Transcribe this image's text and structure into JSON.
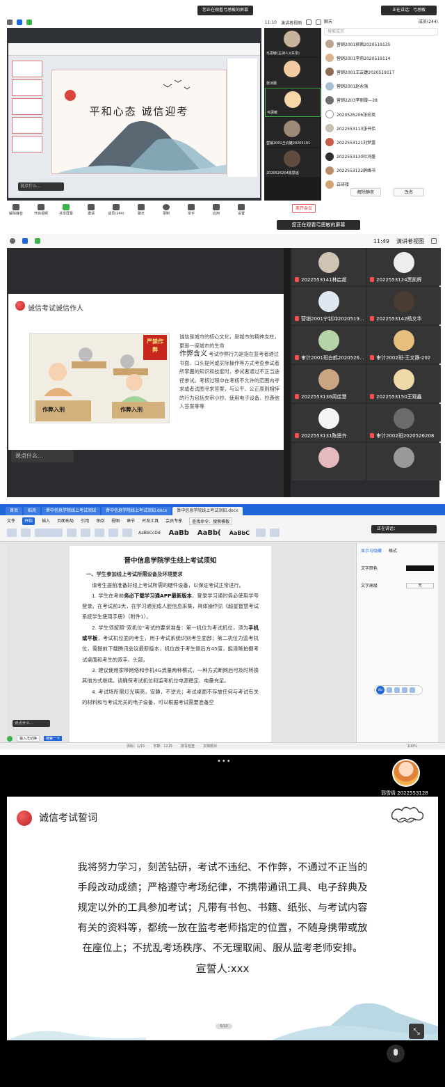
{
  "panel1": {
    "viewing_banner": "您正在观看弓思敏的屏幕",
    "speaking_label": "正在讲话：弓思敏",
    "view_mode": "演讲者视图",
    "time": "11:10",
    "members_title": "成员(244)",
    "chat_label": "聊天",
    "search_placeholder": "搜索成员",
    "slide_title": "平和心态   诚信迎考",
    "comment_placeholder": "说点什么...",
    "video_tiles": [
      {
        "name": "弓思敏(主持人)(共享)"
      },
      {
        "name": "张冰晨"
      },
      {
        "name": "弓思敏"
      },
      {
        "name": "营销2001王云婕20205191"
      },
      {
        "name": "2020526204陈思瑶"
      }
    ],
    "members": [
      {
        "name": "营销2001郭茜2020519135"
      },
      {
        "name": "营销2001李莉2020519114"
      },
      {
        "name": "营销2001王云婕2020519117"
      },
      {
        "name": "营销2001赵永强"
      },
      {
        "name": "营销2203李丽璇—28"
      },
      {
        "name": "2020526206张宏英"
      },
      {
        "name": "2022553113张书伟"
      },
      {
        "name": "2022553121刘梦露"
      },
      {
        "name": "2022553130杜鸿盛"
      },
      {
        "name": "2022553132薛峰书"
      },
      {
        "name": "白研楼"
      }
    ],
    "mute_all_label": "解除静音",
    "rename_label": "改名",
    "toolbar": [
      {
        "label": "解除静音"
      },
      {
        "label": "开启视频"
      },
      {
        "label": "共享屏幕"
      },
      {
        "label": "邀请"
      },
      {
        "label": "成员(244)"
      },
      {
        "label": "聊天"
      },
      {
        "label": "录制"
      },
      {
        "label": "举手"
      },
      {
        "label": "应用"
      },
      {
        "label": "设置"
      }
    ],
    "leave_label": "离开会议"
  },
  "panel2": {
    "viewing_banner": "您正在观看弓思敏的屏幕",
    "time": "11:49",
    "view_mode": "演讲者视图",
    "slide_title": "诚信考试诚信作人",
    "intro_text": "诚信是城市的核心文化，是城市的精神支柱，更是一座城市的生命",
    "heading": "作弊含义",
    "body_text": "考试作弊行为是指在监考者通过书面、口头提问或实际操作等方式考查参试者所掌握的知识和技能时，参试者通过不正当途径参试。考核过程中在考核不允许的范围内寻求或者试图寻求答案，与公平、公正原则相悖的行为包括夹带小抄、使用电子设备、抄袭他人答案等等",
    "sign_left": "作弊入刑",
    "sign_right": "作弊入刑",
    "banner_sign": "严禁作弊",
    "comment_placeholder": "说点什么...",
    "tiles": [
      {
        "name": "2022553141林启超"
      },
      {
        "name": "2022553124贾凯辉"
      },
      {
        "name": "营销2001宁钊冲2020519..."
      },
      {
        "name": "2022553142杨文华"
      },
      {
        "name": "审计2001班白鹤2020526..."
      },
      {
        "name": "审计2002班-王文静-202"
      },
      {
        "name": "2022553136周佳慧"
      },
      {
        "name": "2022553150王观鑫"
      },
      {
        "name": "2022553131陈思齐"
      },
      {
        "name": "审计2002班2020526208"
      },
      {
        "name": ""
      },
      {
        "name": ""
      }
    ]
  },
  "panel3": {
    "tabs": [
      {
        "label": "首页"
      },
      {
        "label": "稻壳"
      },
      {
        "label": "晋中信息学院线上考试须知"
      },
      {
        "label": "晋中信息学院线上考试须知.docx"
      },
      {
        "label": "晋中信息学院线上考试须知.docx"
      }
    ],
    "menu": [
      "文件",
      "开始",
      "插入",
      "页面布局",
      "引用",
      "审阅",
      "视图",
      "章节",
      "开发工具",
      "会员专享"
    ],
    "search_placeholder": "查找命令、搜索模板",
    "styles": [
      "AaBbCcDd",
      "AaBb",
      "AaBb(",
      "AaBbC"
    ],
    "speaker_label": "正在讲话：",
    "doc_title": "晋中信息学院学生线上考试须知",
    "heading1": "一、学生参加线上考试所需设备及环境要求",
    "para0": "请考生提前准备好线上考试所需的硬件设备，以保证考试正常进行。",
    "para1_a": "1. 学生在考前",
    "para1_b": "务必下载学习通APP最新版本",
    "para1_c": "，登录学习通时务必使用学号登录。在考试前3天，在学习通完成人脸信息采集，具体操作见《超星智慧考试系统学生使用手册》（附件1）。",
    "para2_a": "2. 学生须按照\"双机位\"考试的要求准备：第一机位为考试机位，须为",
    "para2_b": "手机或平板",
    "para2_c": "，考试机位面向考生，用于考试系统识别考生面部；第二机位为监考机位，需提前下载腾讯会议最新版本，机位放于考生侧后方45度，能清晰拍摄考试桌面和考生的双手、头部。",
    "para3": "3. 建议使用家带网络和手机4G流量两种模式，一种方式断网后可及时转换其他方式继续。请确保考试机位和监考机位电源稳定、电量充足。",
    "para4": "4. 考试场所需灯光明亮，安静，不逆光；考试桌面不存放任何与考试有关的材料和与考试无关的电子设备，可以根据考试需要准备空",
    "comment_placeholder": "说点什么...",
    "side_tab1": "显示与隐藏",
    "side_tab2": "格式",
    "side_row1": "文字颜色",
    "side_row2": "文字高级",
    "side_row2_value": "无",
    "du_label": "du",
    "taskbar_ime": "输入法切换",
    "taskbar_btn": "搜索一下",
    "status": [
      "页码：1/15",
      "字数：1215",
      "拼写检查",
      "文档校对"
    ],
    "zoom": "100%"
  },
  "panel4": {
    "dots": "•••",
    "avatar_name": "郭雪倩 2022553128",
    "slide_title": "诚信考试誓词",
    "oath_line1": "我将努力学习，刻苦钻研，考试不违纪、不作弊，不通过不正当的",
    "oath_line2": "手段改动成绩；严格遵守考场纪律，不携带通讯工具、电子辞典及",
    "oath_line3": "规定以外的工具参加考试；凡带有书包、书籍、纸张、与考试内容",
    "oath_line4": "有关的资料等，都统一放在监考老师指定的位置，不随身携带或放",
    "oath_line5": "在座位上；不扰乱考场秩序、不无理取闹、服从监考老师安排。",
    "signature": "宣誓人:xxx",
    "page_indicator": "5/10"
  }
}
